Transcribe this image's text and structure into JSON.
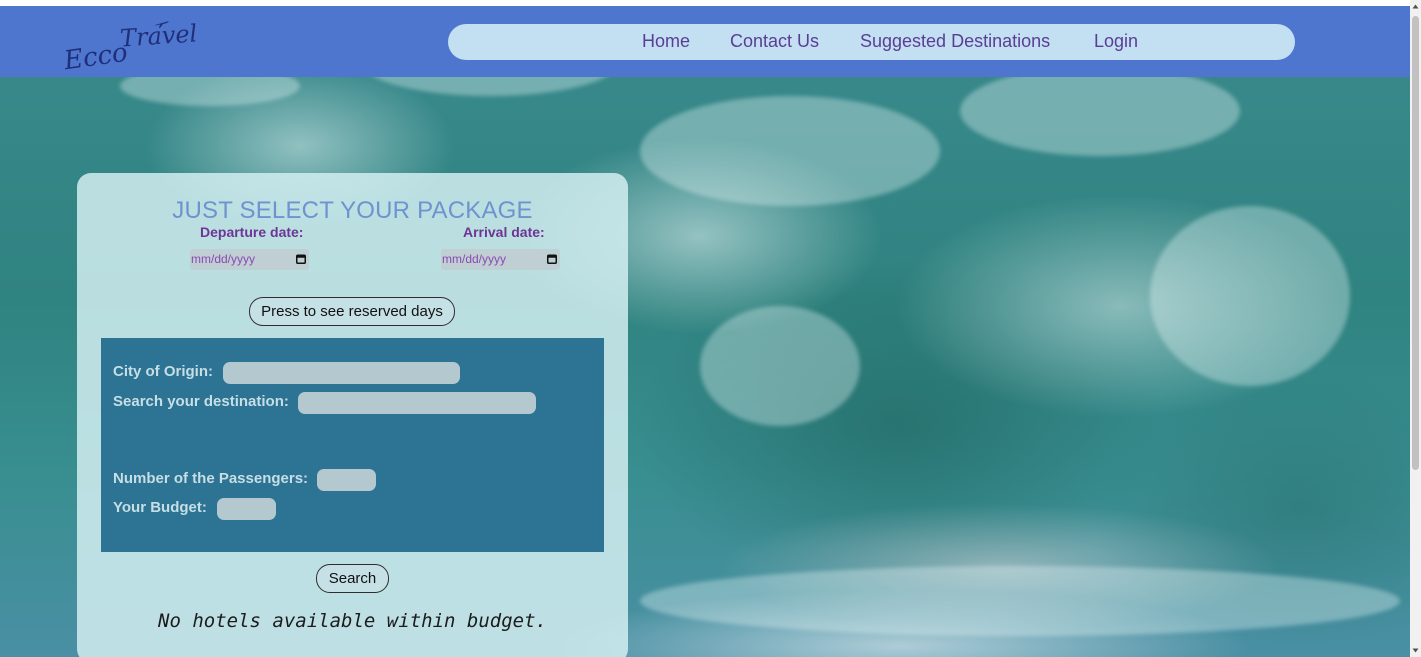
{
  "header": {
    "logo": {
      "text_primary": "Ecco",
      "text_secondary": "Travel"
    },
    "nav": [
      {
        "label": "Home"
      },
      {
        "label": "Contact Us"
      },
      {
        "label": "Suggested Destinations"
      },
      {
        "label": "Login"
      }
    ]
  },
  "package_panel": {
    "title": "JUST SELECT YOUR PACKAGE",
    "departure_label": "Departure date:",
    "arrival_label": "Arrival date:",
    "departure_placeholder": "mm/dd/yyyy",
    "arrival_placeholder": "mm/dd/yyyy",
    "reserved_button": "Press to see reserved days",
    "form": {
      "origin_label": "City of Origin:",
      "destination_label": "Search your destination:",
      "passengers_label": "Number of the Passengers:",
      "budget_label": "Your Budget:",
      "origin_value": "",
      "destination_value": "",
      "passengers_value": "",
      "budget_value": ""
    },
    "search_button": "Search",
    "result_message": "No hotels available within budget."
  },
  "colors": {
    "navbar": "#4f76cf",
    "nav_pill": "#c3dff2",
    "nav_link": "#5a3d95",
    "panel": "#d2eef0",
    "form_box": "#2c7394",
    "title": "#6e93cf",
    "date_label": "#6d3596"
  },
  "icons": {
    "logo_plane": "airplane-icon",
    "date_picker": "calendar-icon"
  }
}
